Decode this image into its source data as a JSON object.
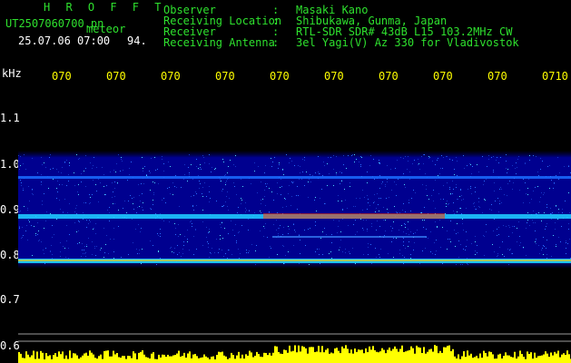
{
  "header": {
    "title": "H R O F F T",
    "filename": "UT2507060700.pn",
    "meteor_label": "meteor",
    "datetime": "25.07.06 07:00",
    "count": "94.",
    "info": [
      {
        "label": "Observer",
        "sep": ":",
        "value": "Masaki Kano"
      },
      {
        "label": "Receiving Location",
        "sep": ":",
        "value": "Shibukawa, Gunma, Japan"
      },
      {
        "label": "Receiver",
        "sep": ":",
        "value": "RTL-SDR SDR# 43dB L15 103.2MHz CW"
      },
      {
        "label": "Receiving Antenna",
        "sep": ":",
        "value": "3el Yagi(V) Az 330 for Vladivostok"
      }
    ]
  },
  "y_axis": {
    "unit": "kHz",
    "ticks": [
      "1.1",
      "1.0",
      "0.9",
      "0.8",
      "0.7",
      "0.6"
    ]
  },
  "x_axis": {
    "ticks": [
      "070",
      "070",
      "070",
      "070",
      "070",
      "070",
      "070",
      "070",
      "070",
      "0710"
    ]
  },
  "colors": {
    "background": "#000000",
    "spectrum_bg": "#00008f",
    "header_green": "#2ee02e",
    "tick_yellow": "#ffff00",
    "signal_bar": "#ffff00"
  }
}
